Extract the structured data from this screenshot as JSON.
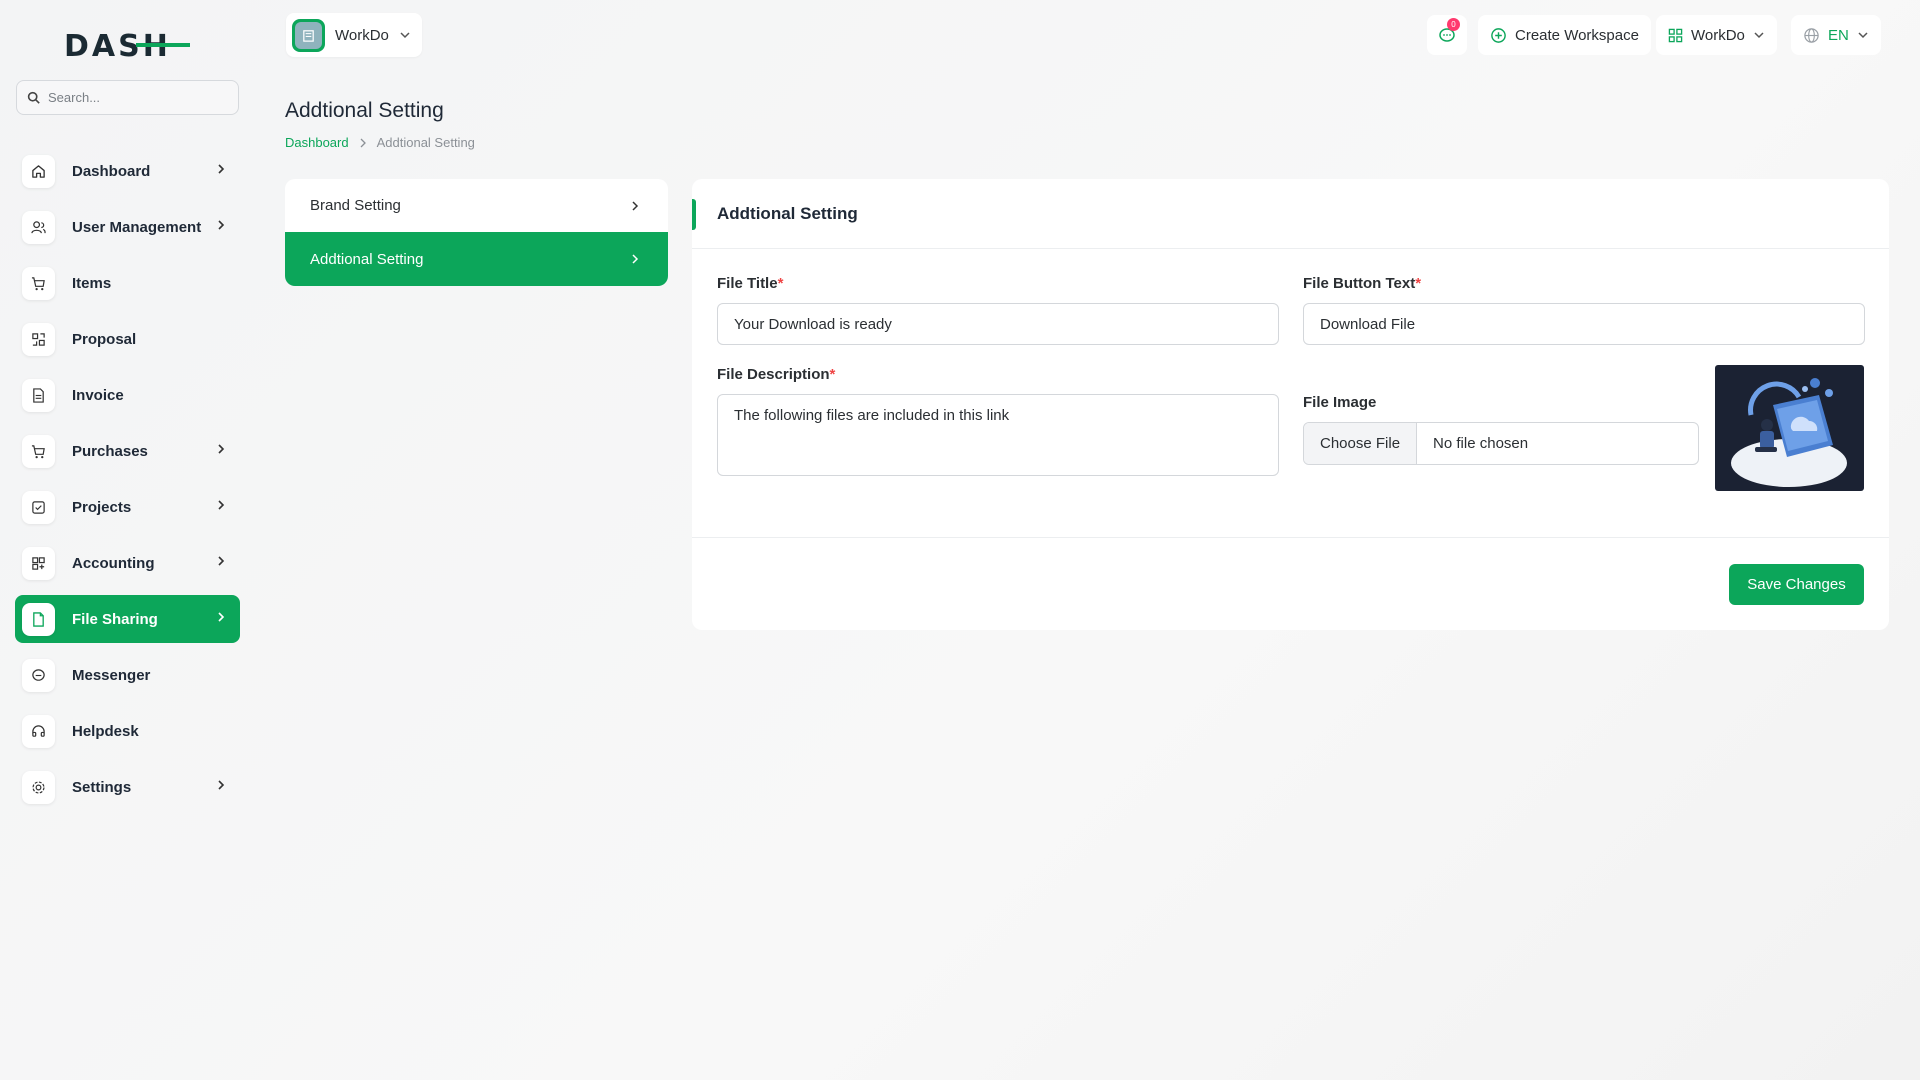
{
  "app": {
    "logo_text": "DASH"
  },
  "search": {
    "placeholder": "Search..."
  },
  "sidebar": {
    "items": [
      {
        "label": "Dashboard",
        "icon": "home-icon",
        "has_chevron": true
      },
      {
        "label": "User Management",
        "icon": "users-icon",
        "has_chevron": true
      },
      {
        "label": "Items",
        "icon": "cart-icon",
        "has_chevron": false
      },
      {
        "label": "Proposal",
        "icon": "proposal-icon",
        "has_chevron": false
      },
      {
        "label": "Invoice",
        "icon": "invoice-icon",
        "has_chevron": false
      },
      {
        "label": "Purchases",
        "icon": "cart-icon",
        "has_chevron": true
      },
      {
        "label": "Projects",
        "icon": "checkbox-icon",
        "has_chevron": true
      },
      {
        "label": "Accounting",
        "icon": "grid-icon",
        "has_chevron": true
      },
      {
        "label": "File Sharing",
        "icon": "file-icon",
        "has_chevron": true,
        "active": true
      },
      {
        "label": "Messenger",
        "icon": "chat-icon",
        "has_chevron": false
      },
      {
        "label": "Helpdesk",
        "icon": "headset-icon",
        "has_chevron": false
      },
      {
        "label": "Settings",
        "icon": "gear-icon",
        "has_chevron": true
      }
    ]
  },
  "header": {
    "workspace_name": "WorkDo",
    "notification_count": "0",
    "create_workspace_label": "Create Workspace",
    "workspace_menu_label": "WorkDo",
    "language": "EN"
  },
  "page": {
    "title": "Addtional Setting",
    "breadcrumb": {
      "home": "Dashboard",
      "current": "Addtional Setting"
    }
  },
  "settings_menu": {
    "items": [
      {
        "label": "Brand Setting",
        "active": false
      },
      {
        "label": "Addtional Setting",
        "active": true
      }
    ]
  },
  "form": {
    "card_title": "Addtional Setting",
    "file_title_label": "File Title",
    "file_title_value": "Your Download is ready",
    "file_button_text_label": "File Button Text",
    "file_button_text_value": "Download File",
    "file_description_label": "File Description",
    "file_description_value": "The following files are included in this link",
    "file_image_label": "File Image",
    "choose_file_label": "Choose File",
    "no_file_label": "No file chosen",
    "required_mark": "*",
    "save_label": "Save Changes"
  },
  "colors": {
    "accent": "#0ca65a",
    "badge": "#ff3a6e",
    "required": "#ef4444"
  }
}
